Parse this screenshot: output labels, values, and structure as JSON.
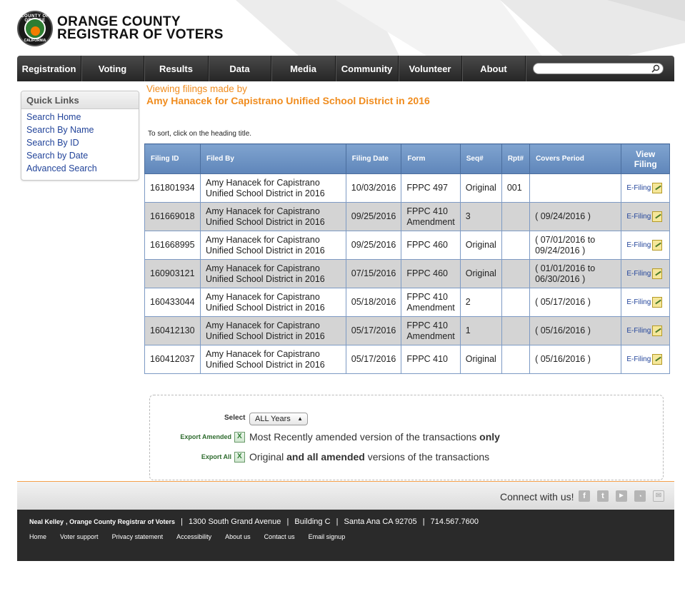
{
  "header": {
    "seal_top": "COUNTY OF ORANGE",
    "seal_bottom": "CALIFORNIA",
    "brand_line1": "ORANGE COUNTY",
    "brand_line2": "REGISTRAR OF VOTERS"
  },
  "nav": {
    "items": [
      "Registration",
      "Voting",
      "Results",
      "Data",
      "Media",
      "Community",
      "Volunteer",
      "About"
    ],
    "search_placeholder": ""
  },
  "quick_links": {
    "title": "Quick Links",
    "items": [
      "Search Home",
      "Search By Name",
      "Search By ID",
      "Search by Date",
      "Advanced Search"
    ]
  },
  "viewing": {
    "line1": "Viewing filings made by",
    "line2": "Amy Hanacek for Capistrano Unified School District in 2016"
  },
  "sort_hint": "To sort, click on the heading title.",
  "table": {
    "headers": [
      "Filing ID",
      "Filed By",
      "Filing Date",
      "Form",
      "Seq#",
      "Rpt#",
      "Covers Period",
      "View Filing"
    ],
    "rows": [
      {
        "id": "161801934",
        "filer1": "Amy Hanacek for Capistrano",
        "filer2": "Unified School District in 2016",
        "date": "10/03/2016",
        "form1": "FPPC 497",
        "form2": "",
        "seq": "Original",
        "rpt": "001",
        "period1": "",
        "period2": "",
        "view": "E-Filing"
      },
      {
        "id": "161669018",
        "filer1": "Amy Hanacek for Capistrano",
        "filer2": "Unified School District in 2016",
        "date": "09/25/2016",
        "form1": "FPPC 410",
        "form2": "Amendment",
        "seq": "3",
        "rpt": "",
        "period1": "( 09/24/2016 )",
        "period2": "",
        "view": "E-Filing"
      },
      {
        "id": "161668995",
        "filer1": "Amy Hanacek for Capistrano",
        "filer2": "Unified School District in 2016",
        "date": "09/25/2016",
        "form1": "FPPC 460",
        "form2": "",
        "seq": "Original",
        "rpt": "",
        "period1": "( 07/01/2016 to",
        "period2": "09/24/2016 )",
        "view": "E-Filing"
      },
      {
        "id": "160903121",
        "filer1": "Amy Hanacek for Capistrano",
        "filer2": "Unified School District in 2016",
        "date": "07/15/2016",
        "form1": "FPPC 460",
        "form2": "",
        "seq": "Original",
        "rpt": "",
        "period1": "( 01/01/2016 to",
        "period2": "06/30/2016 )",
        "view": "E-Filing"
      },
      {
        "id": "160433044",
        "filer1": "Amy Hanacek for Capistrano",
        "filer2": "Unified School District in 2016",
        "date": "05/18/2016",
        "form1": "FPPC 410",
        "form2": "Amendment",
        "seq": "2",
        "rpt": "",
        "period1": "( 05/17/2016 )",
        "period2": "",
        "view": "E-Filing"
      },
      {
        "id": "160412130",
        "filer1": "Amy Hanacek for Capistrano",
        "filer2": "Unified School District in 2016",
        "date": "05/17/2016",
        "form1": "FPPC 410",
        "form2": "Amendment",
        "seq": "1",
        "rpt": "",
        "period1": "( 05/16/2016 )",
        "period2": "",
        "view": "E-Filing"
      },
      {
        "id": "160412037",
        "filer1": "Amy Hanacek for Capistrano",
        "filer2": "Unified School District in 2016",
        "date": "05/17/2016",
        "form1": "FPPC 410",
        "form2": "",
        "seq": "Original",
        "rpt": "",
        "period1": "( 05/16/2016 )",
        "period2": "",
        "view": "E-Filing"
      }
    ]
  },
  "export": {
    "select_label": "Select",
    "year_value": "ALL Years",
    "amended_link": "Export Amended",
    "amended_desc_pre": "Most Recently amended version of the transactions",
    "amended_desc_bold": "only",
    "all_link": "Export All",
    "all_desc_pre": "Original",
    "all_desc_bold": "and all amended",
    "all_desc_post": "versions of the transactions"
  },
  "connect": {
    "label": "Connect with us!",
    "icons": [
      "facebook-icon",
      "twitter-icon",
      "youtube-icon",
      "rss-icon",
      "email-icon"
    ]
  },
  "footer": {
    "name": "Neal Kelley",
    "title": ", Orange County Registrar of Voters",
    "address": "1300 South Grand Avenue",
    "building": "Building C",
    "city": "Santa Ana CA 92705",
    "phone": "714.567.7600",
    "links": [
      "Home",
      "Voter support",
      "Privacy statement",
      "Accessibility",
      "About us",
      "Contact us",
      "Email signup"
    ]
  },
  "colors": {
    "accent_orange": "#f08c1e",
    "nav_dark": "#2e2e2e",
    "table_header_blue": "#6f93c4",
    "link_blue": "#22449a"
  }
}
